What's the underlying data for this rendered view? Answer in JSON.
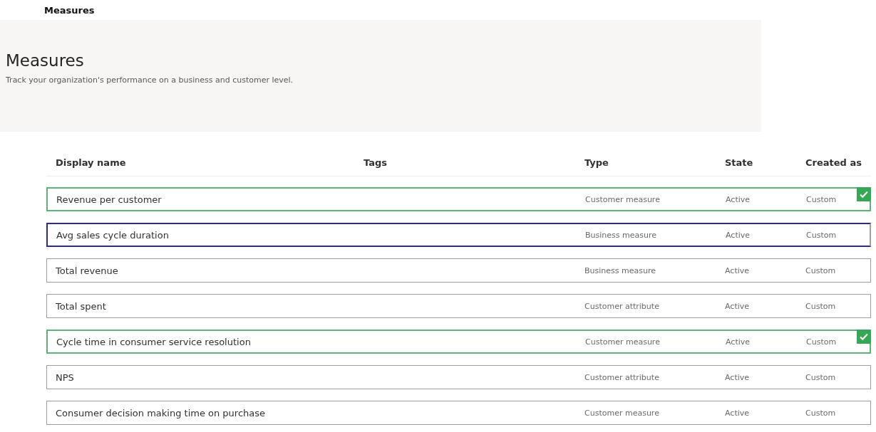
{
  "breadcrumb": "Measures",
  "page": {
    "title": "Measures",
    "description": "Track your organization's performance on a business and customer level."
  },
  "table": {
    "columns": [
      "Display name",
      "Tags",
      "Type",
      "State",
      "Created as"
    ],
    "rows": [
      {
        "kind": "correct",
        "display_name": "Revenue per customer",
        "type": "Customer measure",
        "state": "Active",
        "created_as": "Custom"
      },
      {
        "kind": "focused",
        "display_name": "Avg sales cycle duration",
        "type": "Business measure",
        "state": "Active",
        "created_as": "Custom"
      },
      {
        "kind": "plain",
        "display_name": "Total revenue",
        "type": "Business measure",
        "state": "Active",
        "created_as": "Custom"
      },
      {
        "kind": "plain",
        "display_name": "Total spent",
        "type": "Customer attribute",
        "state": "Active",
        "created_as": "Custom"
      },
      {
        "kind": "correct",
        "display_name": "Cycle time in consumer service resolution",
        "type": "Customer measure",
        "state": "Active",
        "created_as": "Custom"
      },
      {
        "kind": "plain",
        "display_name": "NPS",
        "type": "Customer attribute",
        "state": "Active",
        "created_as": "Custom"
      },
      {
        "kind": "plain",
        "display_name": "Consumer decision making time on purchase",
        "type": "Customer measure",
        "state": "Active",
        "created_as": "Custom"
      }
    ]
  }
}
